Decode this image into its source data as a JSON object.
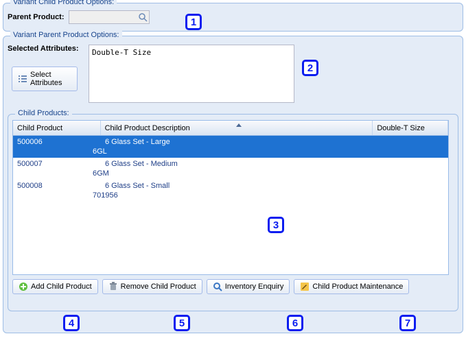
{
  "childOptions": {
    "legend": "Variant Child Product Options:",
    "parentLabel": "Parent Product:",
    "parentValue": ""
  },
  "parentOptions": {
    "legend": "Variant Parent Product Options:",
    "selectedAttrsLabel": "Selected Attributes:",
    "selectedAttrsValue": "Double-T Size",
    "selectAttributesBtn": "Select Attributes"
  },
  "childProducts": {
    "legend": "Child Products:",
    "columns": {
      "code": "Child Product",
      "desc": "Child Product Description",
      "size": "Double-T Size"
    },
    "rows": [
      {
        "code": "500006",
        "sub": "6GL",
        "desc": "6 Glass Set - Large",
        "size": "",
        "selected": true
      },
      {
        "code": "500007",
        "sub": "6GM",
        "desc": "6 Glass Set - Medium",
        "size": "",
        "selected": false
      },
      {
        "code": "500008",
        "sub": "701956",
        "desc": "6 Glass Set - Small",
        "size": "",
        "selected": false
      }
    ]
  },
  "buttons": {
    "add": "Add Child Product",
    "remove": "Remove Child Product",
    "inventory": "Inventory Enquiry",
    "maintenance": "Child Product Maintenance"
  },
  "callouts": {
    "c1": "1",
    "c2": "2",
    "c3": "3",
    "c4": "4",
    "c5": "5",
    "c6": "6",
    "c7": "7"
  }
}
